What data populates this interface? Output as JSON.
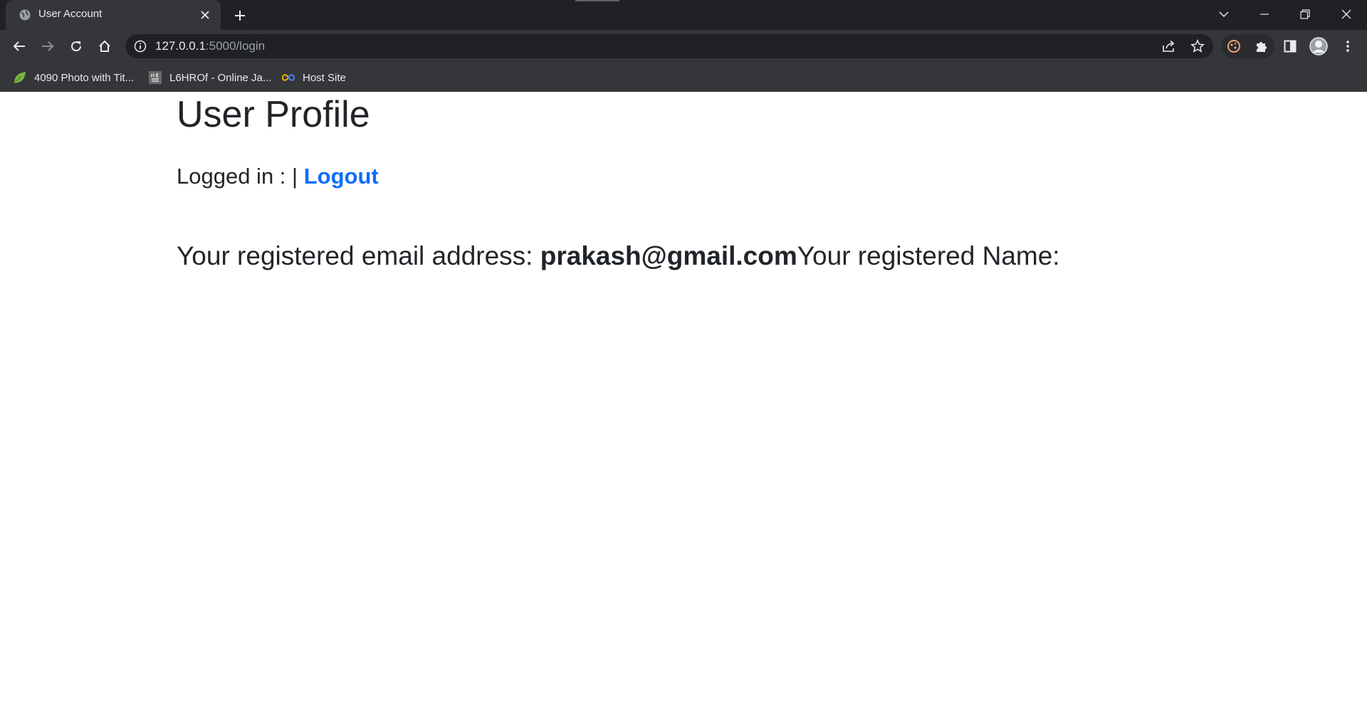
{
  "browser": {
    "tab_title": "User Account",
    "url_host": "127.0.0.1",
    "url_path": ":5000/login",
    "bookmarks": [
      {
        "label": "4090 Photo with Tit...",
        "icon": "leaf-icon"
      },
      {
        "label": "L6HROf - Online Ja...",
        "icon": "ideone-icon"
      },
      {
        "label": "Host Site",
        "icon": "infinity-icon"
      }
    ]
  },
  "page": {
    "title": "User Profile",
    "logged_in_label": "Logged in :",
    "separator": "|",
    "logout_label": "Logout",
    "email_label": "Your registered email address:",
    "email_value": "prakash@gmail.com",
    "name_label": "Your registered Name:"
  },
  "colors": {
    "link": "#0d6efd",
    "text": "#212529",
    "chrome_dark": "#202124",
    "chrome_toolbar": "#35363a"
  }
}
